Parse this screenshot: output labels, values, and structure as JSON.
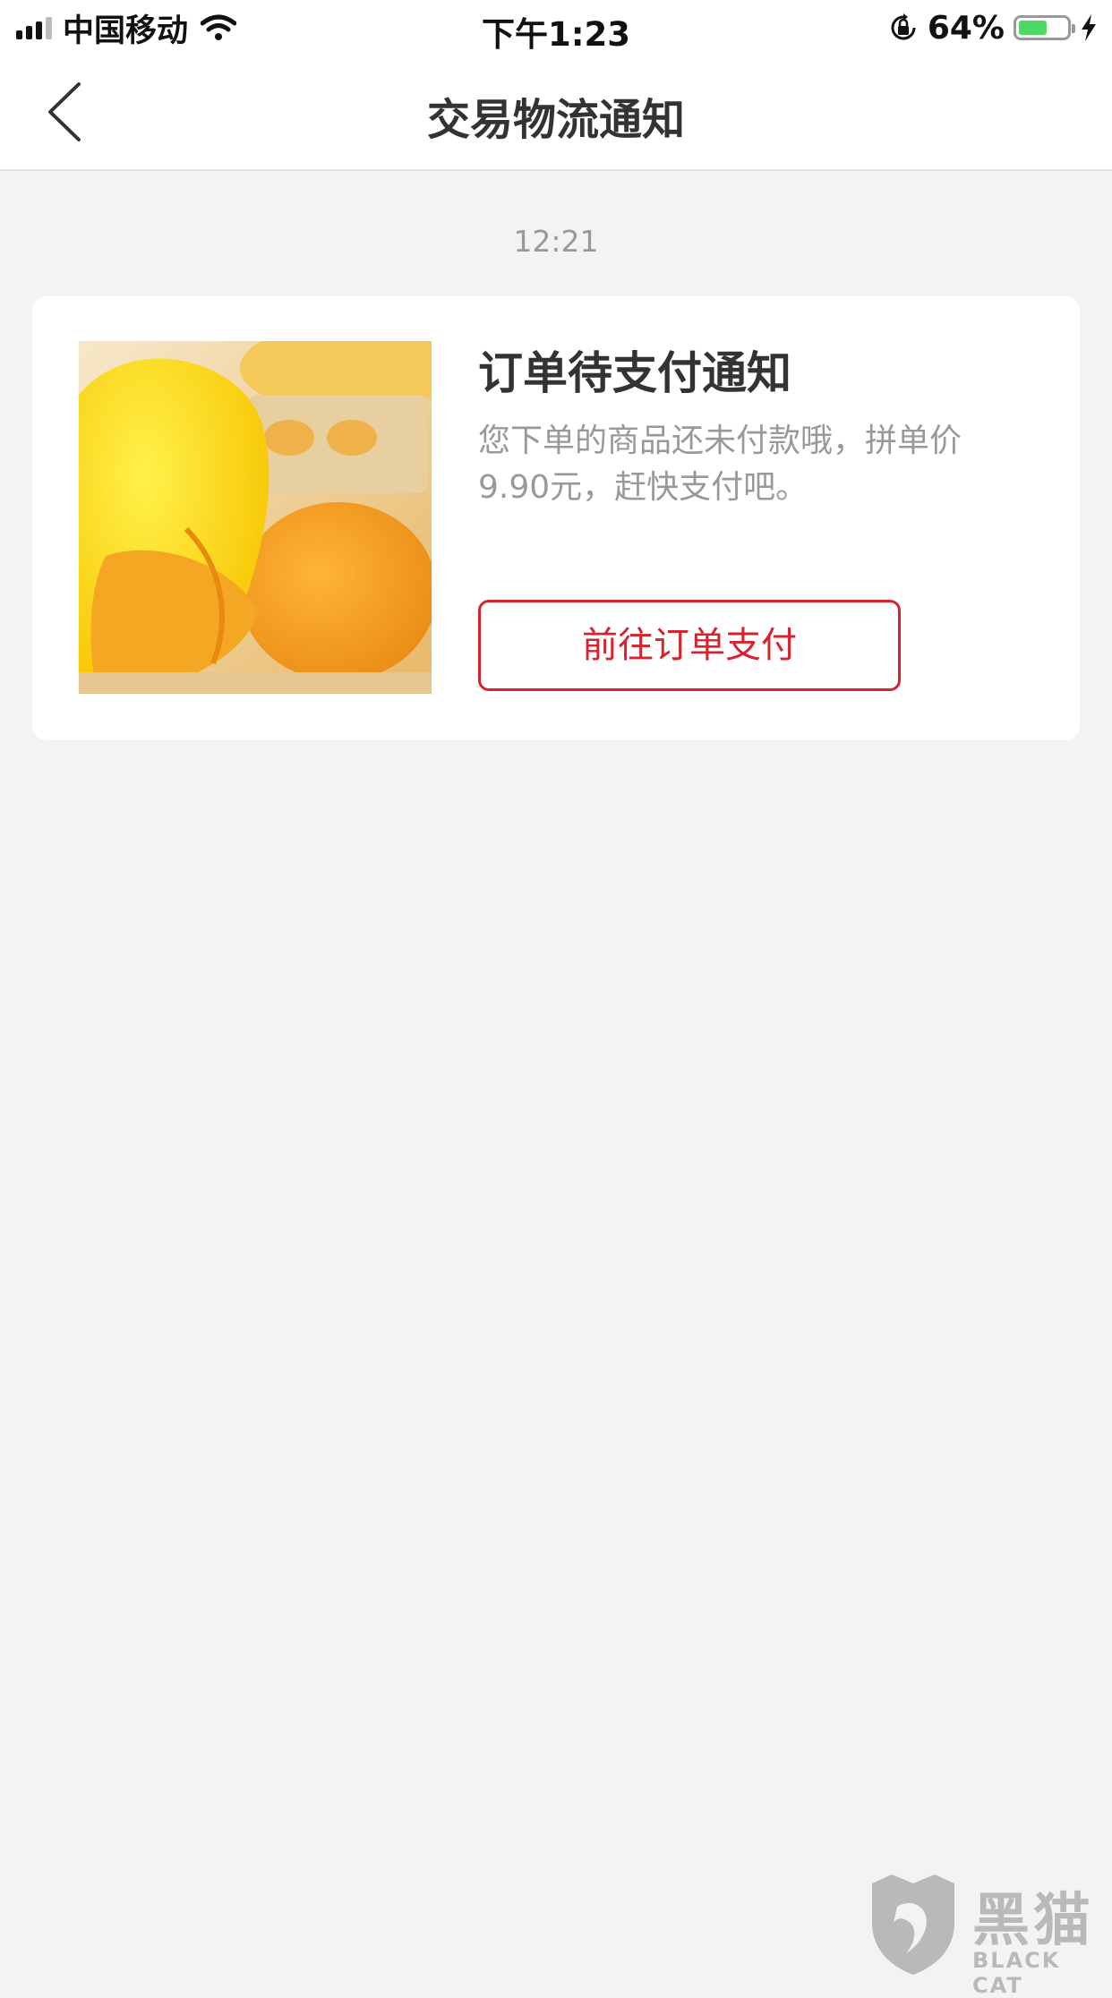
{
  "status_bar": {
    "carrier": "中国移动",
    "time": "下午1:23",
    "battery_percent": "64%",
    "battery_level": 0.64,
    "icons": [
      "signal-icon",
      "wifi-icon",
      "orientation-lock-icon",
      "battery-icon",
      "charging-icon"
    ]
  },
  "nav": {
    "title": "交易物流通知",
    "back_icon": "chevron-left-icon"
  },
  "message": {
    "time": "12:21",
    "title": "订单待支付通知",
    "description": "您下单的商品还未付款哦，拼单价9.90元，赶快支付吧。",
    "button_label": "前往订单支付",
    "accent_color": "#d6232c"
  },
  "watermark": {
    "title": "黑猫",
    "subtitle": "BLACK CAT"
  }
}
